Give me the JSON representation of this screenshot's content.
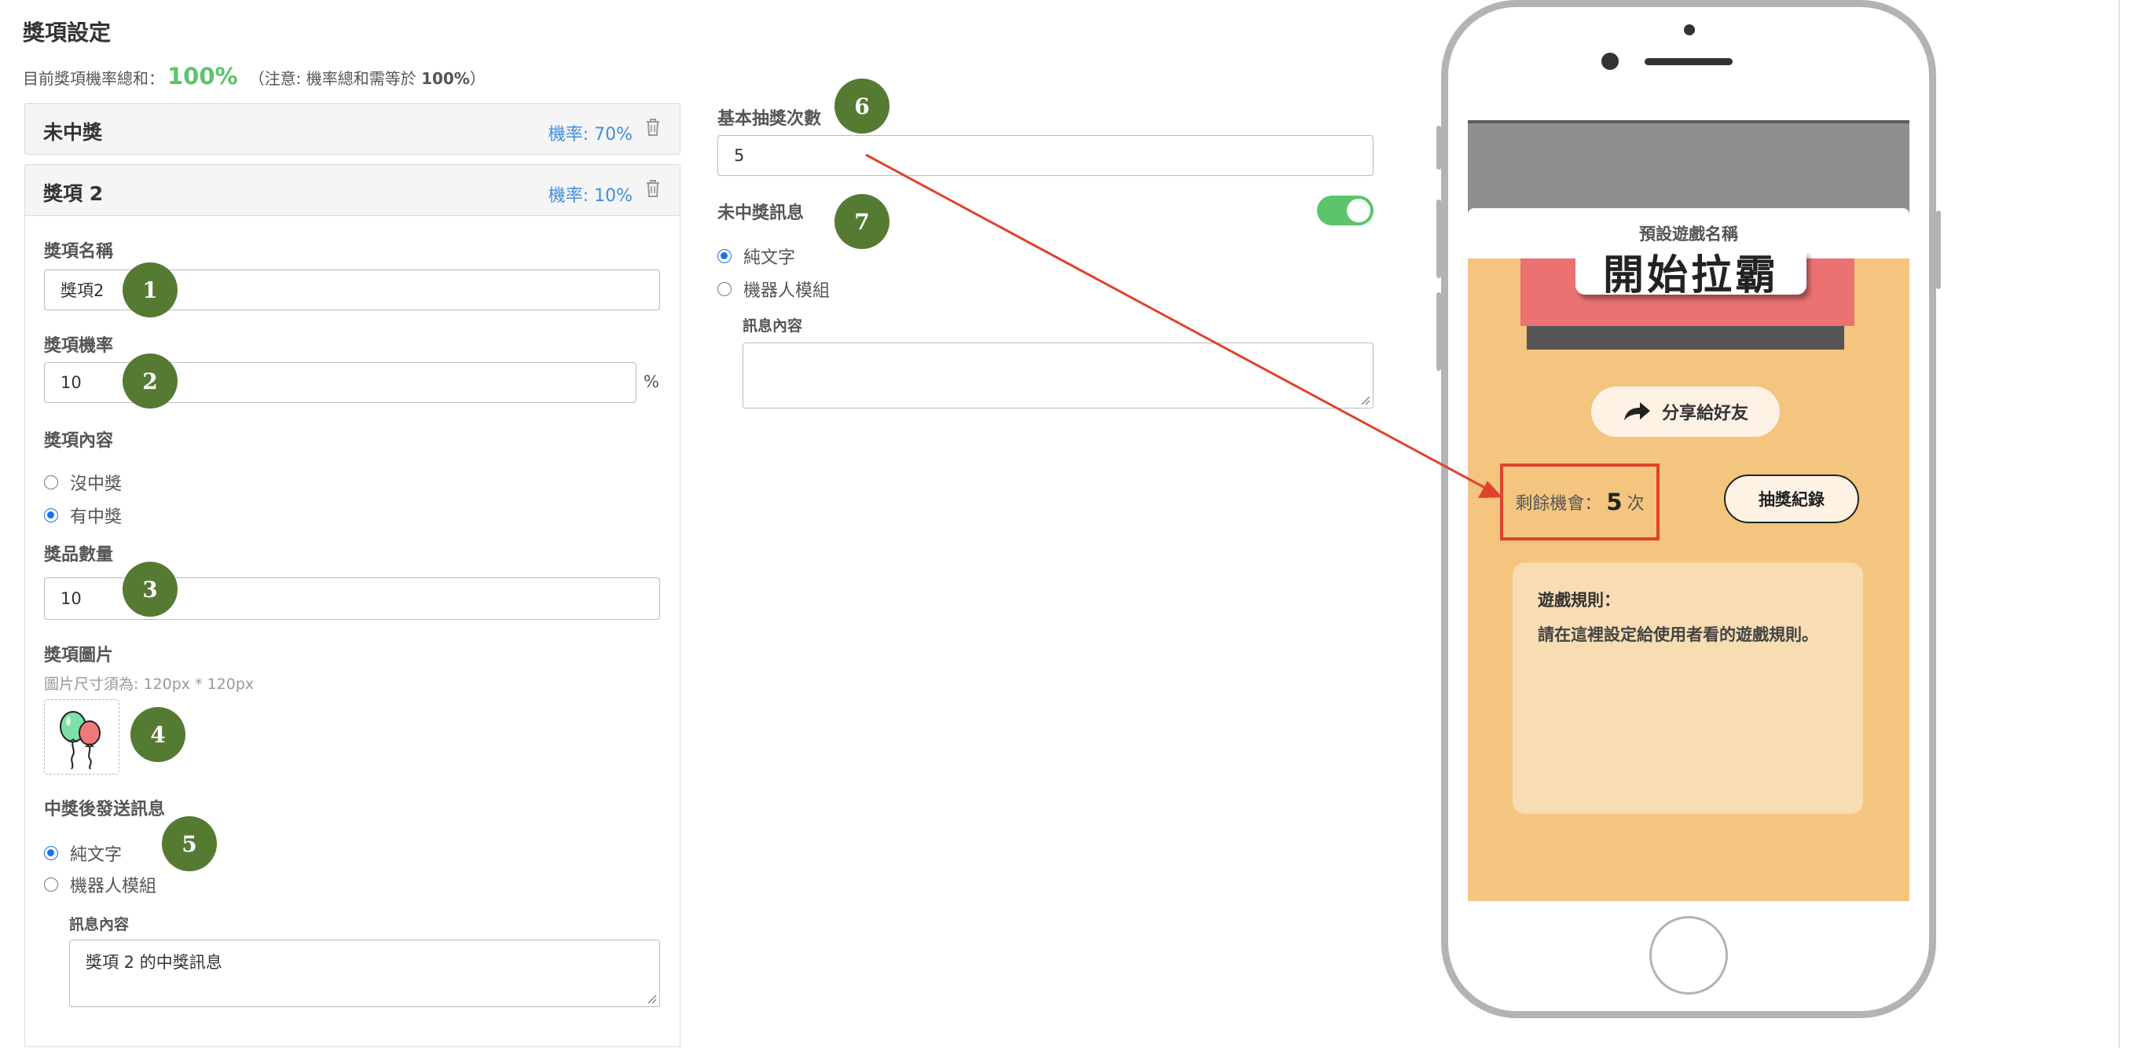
{
  "page": {
    "title": "獎項設定"
  },
  "summary": {
    "label": "目前獎項機率總和：",
    "percent": "100%",
    "note_prefix": "（注意: 機率總和需等於",
    "note_value": "100%",
    "note_suffix": "）"
  },
  "prizes": [
    {
      "name": "未中獎",
      "rate": "機率: 70%"
    },
    {
      "name": "獎項 2",
      "rate": "機率: 10%"
    }
  ],
  "prize_form": {
    "name_label": "獎項名稱",
    "name_value": "獎項2",
    "prob_label": "獎項機率",
    "prob_value": "10",
    "prob_unit": "%",
    "content_label": "獎項內容",
    "content_options": [
      "沒中獎",
      "有中獎"
    ],
    "content_selected": "有中獎",
    "qty_label": "獎品數量",
    "qty_value": "10",
    "image_label": "獎項圖片",
    "image_hint": "圖片尺寸須為: 120px * 120px",
    "msg_label": "中獎後發送訊息",
    "msg_options": [
      "純文字",
      "機器人模組"
    ],
    "msg_selected": "純文字",
    "msg_content_label": "訊息內容",
    "msg_content_value": "獎項 2 的中獎訊息"
  },
  "draw_settings": {
    "base_count_label": "基本抽獎次數",
    "base_count_value": "5",
    "no_win_label": "未中獎訊息",
    "no_win_enabled": true,
    "msg_options": [
      "純文字",
      "機器人模組"
    ],
    "msg_selected": "純文字",
    "msg_content_label": "訊息內容",
    "msg_content_value": ""
  },
  "badges": [
    "1",
    "2",
    "3",
    "4",
    "5",
    "6",
    "7"
  ],
  "phone_preview": {
    "game_title": "預設遊戲名稱",
    "banner_text": "開始拉霸",
    "share_label": "分享給好友",
    "remain_label": "剩餘機會：",
    "remain_count": "5",
    "remain_unit": "次",
    "record_label": "抽獎紀錄",
    "rules_title": "遊戲規則：",
    "rules_body": "請在這裡設定給使用者看的遊戲規則。"
  },
  "colors": {
    "accent_green": "#5cc46b",
    "rate_blue": "#3f8fe0",
    "badge_green": "#557a32",
    "annotation_red": "#e0432d",
    "game_bg": "#f3c57f"
  },
  "icons": {
    "trash": "trash-icon",
    "share": "share-arrow-icon",
    "prize_image": "balloons-icon"
  }
}
